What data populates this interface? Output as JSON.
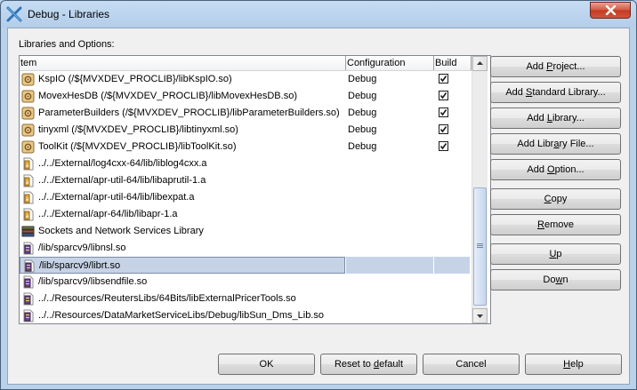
{
  "window": {
    "title": "Debug - Libraries"
  },
  "group_label": "Libraries and Options:",
  "columns": {
    "item": "tem",
    "configuration": "Configuration",
    "build": "Build"
  },
  "rows": [
    {
      "icon": "project-icon",
      "text": "KspIO (/${MVXDEV_PROCLIB}/libKspIO.so)",
      "config": "Debug",
      "build": true
    },
    {
      "icon": "project-icon",
      "text": "MovexHesDB (/${MVXDEV_PROCLIB}/libMovexHesDB.so)",
      "config": "Debug",
      "build": true
    },
    {
      "icon": "project-icon",
      "text": "ParameterBuilders (/${MVXDEV_PROCLIB}/libParameterBuilders.so)",
      "config": "Debug",
      "build": true
    },
    {
      "icon": "project-icon",
      "text": "tinyxml (/${MVXDEV_PROCLIB}/libtinyxml.so)",
      "config": "Debug",
      "build": true
    },
    {
      "icon": "project-icon",
      "text": "ToolKit (/${MVXDEV_PROCLIB}/libToolKit.so)",
      "config": "Debug",
      "build": true
    },
    {
      "icon": "archive-file-icon",
      "text": "../../External/log4cxx-64/lib/liblog4cxx.a",
      "config": "",
      "build": null
    },
    {
      "icon": "archive-file-icon",
      "text": "../../External/apr-util-64/lib/libaprutil-1.a",
      "config": "",
      "build": null
    },
    {
      "icon": "archive-file-icon",
      "text": "../../External/apr-util-64/lib/libexpat.a",
      "config": "",
      "build": null
    },
    {
      "icon": "archive-file-icon",
      "text": "../../External/apr-64/lib/libapr-1.a",
      "config": "",
      "build": null
    },
    {
      "icon": "standard-library-icon",
      "text": "Sockets and Network Services Library",
      "config": "",
      "build": null
    },
    {
      "icon": "shared-library-icon",
      "text": "/lib/sparcv9/libnsl.so",
      "config": "",
      "build": null
    },
    {
      "icon": "shared-library-icon",
      "text": "/lib/sparcv9/librt.so",
      "config": "",
      "build": null,
      "selected": true
    },
    {
      "icon": "shared-library-icon",
      "text": "/lib/sparcv9/libsendfile.so",
      "config": "",
      "build": null
    },
    {
      "icon": "shared-library-icon",
      "text": "../../Resources/ReutersLibs/64Bits/libExternalPricerTools.so",
      "config": "",
      "build": null
    },
    {
      "icon": "shared-library-icon",
      "text": "../../Resources/DataMarketServiceLibs/Debug/libSun_Dms_Lib.so",
      "config": "",
      "build": null
    }
  ],
  "side_buttons": [
    {
      "name": "add-project-button",
      "pre": "Add ",
      "u": "P",
      "post": "roject..."
    },
    {
      "name": "add-standard-library-button",
      "pre": "Add ",
      "u": "S",
      "post": "tandard Library..."
    },
    {
      "name": "add-library-button",
      "pre": "Add ",
      "u": "L",
      "post": "ibrary..."
    },
    {
      "name": "add-library-file-button",
      "pre": "Add Libr",
      "u": "a",
      "post": "ry File..."
    },
    {
      "name": "add-option-button",
      "pre": "Add ",
      "u": "O",
      "post": "ption..."
    },
    {
      "name": "copy-button",
      "pre": "",
      "u": "C",
      "post": "opy"
    },
    {
      "name": "remove-button",
      "pre": "",
      "u": "R",
      "post": "emove"
    },
    {
      "name": "up-button",
      "pre": "",
      "u": "U",
      "post": "p"
    },
    {
      "name": "down-button",
      "pre": "Do",
      "u": "w",
      "post": "n"
    }
  ],
  "bottom_buttons": {
    "ok": "OK",
    "reset_pre": "Reset to ",
    "reset_u": "d",
    "reset_post": "efault",
    "cancel": "Cancel",
    "help_pre": "",
    "help_u": "H",
    "help_post": "elp"
  },
  "colors": {
    "selection": "#c6d3e6",
    "close_button": "#c94a2f"
  }
}
